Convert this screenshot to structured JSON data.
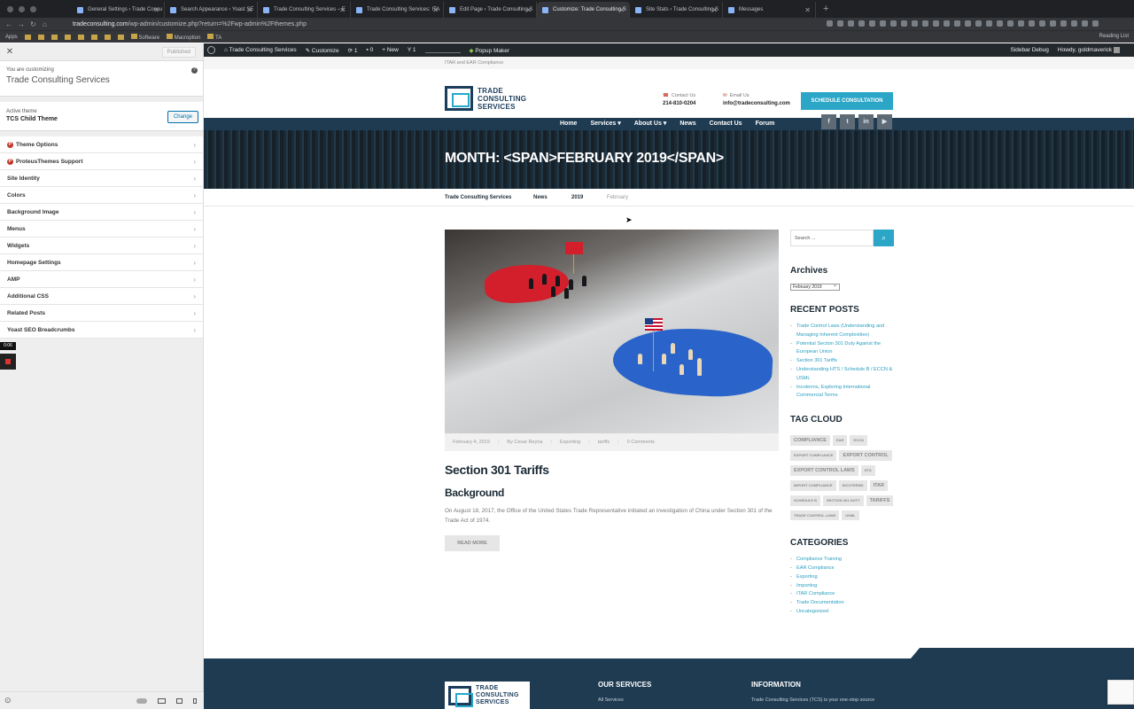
{
  "browser": {
    "tabs": [
      {
        "label": "General Settings ‹ Trade Consu"
      },
      {
        "label": "Search Appearance ‹ Yoast SE"
      },
      {
        "label": "Trade Consulting Services – E"
      },
      {
        "label": "Trade Consulting Services: ITA"
      },
      {
        "label": "Edit Page ‹ Trade Consulting S"
      },
      {
        "label": "Customize: Trade Consulting S"
      },
      {
        "label": "Site Stats ‹ Trade Consulting S"
      },
      {
        "label": "Messages"
      }
    ],
    "url_host": "tradeconsulting.com",
    "url_path": "/wp-admin/customize.php?return=%2Fwp-admin%2Fthemes.php",
    "bookmarks": [
      "Apps",
      "Software",
      "Macroption",
      "TA"
    ],
    "reading_list": "Reading List"
  },
  "wpbar": {
    "site": "Trade Consulting Services",
    "customize": "Customize",
    "updates": "1",
    "comments": "0",
    "new": "New",
    "yoast_count": "1",
    "popup": "Popup Maker",
    "sidebar_debug": "Sidebar Debug",
    "howdy": "Howdy, goldmaverick"
  },
  "panel": {
    "published": "Published",
    "customizing_label": "You are customizing",
    "site_name": "Trade Consulting Services",
    "active_theme_label": "Active theme",
    "theme_name": "TCS Child Theme",
    "change": "Change",
    "items": [
      {
        "label": "Theme Options"
      },
      {
        "label": "ProteusThemes Support"
      },
      {
        "label": "Site Identity"
      },
      {
        "label": "Colors"
      },
      {
        "label": "Background Image"
      },
      {
        "label": "Menus"
      },
      {
        "label": "Widgets"
      },
      {
        "label": "Homepage Settings"
      },
      {
        "label": "AMP"
      },
      {
        "label": "Additional CSS"
      },
      {
        "label": "Related Posts"
      },
      {
        "label": "Yoast SEO Breadcrumbs"
      }
    ],
    "timer": "0:06"
  },
  "site": {
    "topstrip": "ITAR and EAR Compliance",
    "logo_lines": [
      "TRADE",
      "CONSULTING",
      "SERVICES"
    ],
    "contact_us_label": "Contact Us",
    "phone": "214-810-0204",
    "email_label": "Email Us",
    "email": "info@tradeconsulting.com",
    "schedule": "SCHEDULE CONSULTATION",
    "nav": [
      "Home",
      "Services",
      "About Us",
      "News",
      "Contact Us",
      "Forum"
    ],
    "hero_title": "MONTH: <SPAN>FEBRUARY 2019</SPAN>",
    "breadcrumbs": [
      "Trade Consulting Services",
      "News",
      "2019",
      "February"
    ],
    "post": {
      "date": "February 4, 2019",
      "author": "By Cesar Reyna",
      "category": "Exporting",
      "tag": "tariffs",
      "comments": "0 Comments",
      "title": "Section 301 Tariffs",
      "subtitle": "Background",
      "excerpt": "On August 18, 2017, the Office of the United States Trade Representative initiated an investigation of China under Section 301 of the Trade Act of 1974.",
      "read_more": "READ MORE"
    },
    "sidebar": {
      "search_placeholder": "Search ...",
      "archives_title": "Archives",
      "archive_selected": "February 2019",
      "recent_title": "RECENT POSTS",
      "recent": [
        "Trade Control Laws (Understanding and Managing Inherent Complexities)",
        "Potential Section 301 Duty Against the European Union",
        "Section 301 Tariffs",
        "Understanding HTS / Schedule B / ECCN & USML",
        "Incoterms, Exploring International Commercial Terms"
      ],
      "tag_title": "TAG CLOUD",
      "tags": [
        {
          "t": "COMPLIANCE",
          "big": true
        },
        {
          "t": "EAR",
          "big": false
        },
        {
          "t": "ECCN",
          "big": false
        },
        {
          "t": "EXPORT COMPLIANCE",
          "big": false
        },
        {
          "t": "EXPORT CONTROL",
          "big": true
        },
        {
          "t": "EXPORT CONTROL LAWS",
          "big": true
        },
        {
          "t": "HTS",
          "big": false
        },
        {
          "t": "IMPORT COMPLIANCE",
          "big": false
        },
        {
          "t": "INCOTERMS",
          "big": false
        },
        {
          "t": "ITAR",
          "big": true
        },
        {
          "t": "SCHEDULE B",
          "big": false
        },
        {
          "t": "SECTION 301 DUTY",
          "big": false
        },
        {
          "t": "TARIFFS",
          "big": true
        },
        {
          "t": "TRADE CONTROL LAWS",
          "big": false
        },
        {
          "t": "USML",
          "big": false
        }
      ],
      "cat_title": "CATEGORIES",
      "categories": [
        "Compliance Training",
        "EAR Compliance",
        "Exporting",
        "Importing",
        "ITAR Compliance",
        "Trade Documentation",
        "Uncategorized"
      ]
    },
    "footer": {
      "services_title": "OUR SERVICES",
      "services_first": "All Services",
      "info_title": "INFORMATION",
      "info_text": "Trade Consulting Services (TCS) is your one-stop source"
    }
  }
}
